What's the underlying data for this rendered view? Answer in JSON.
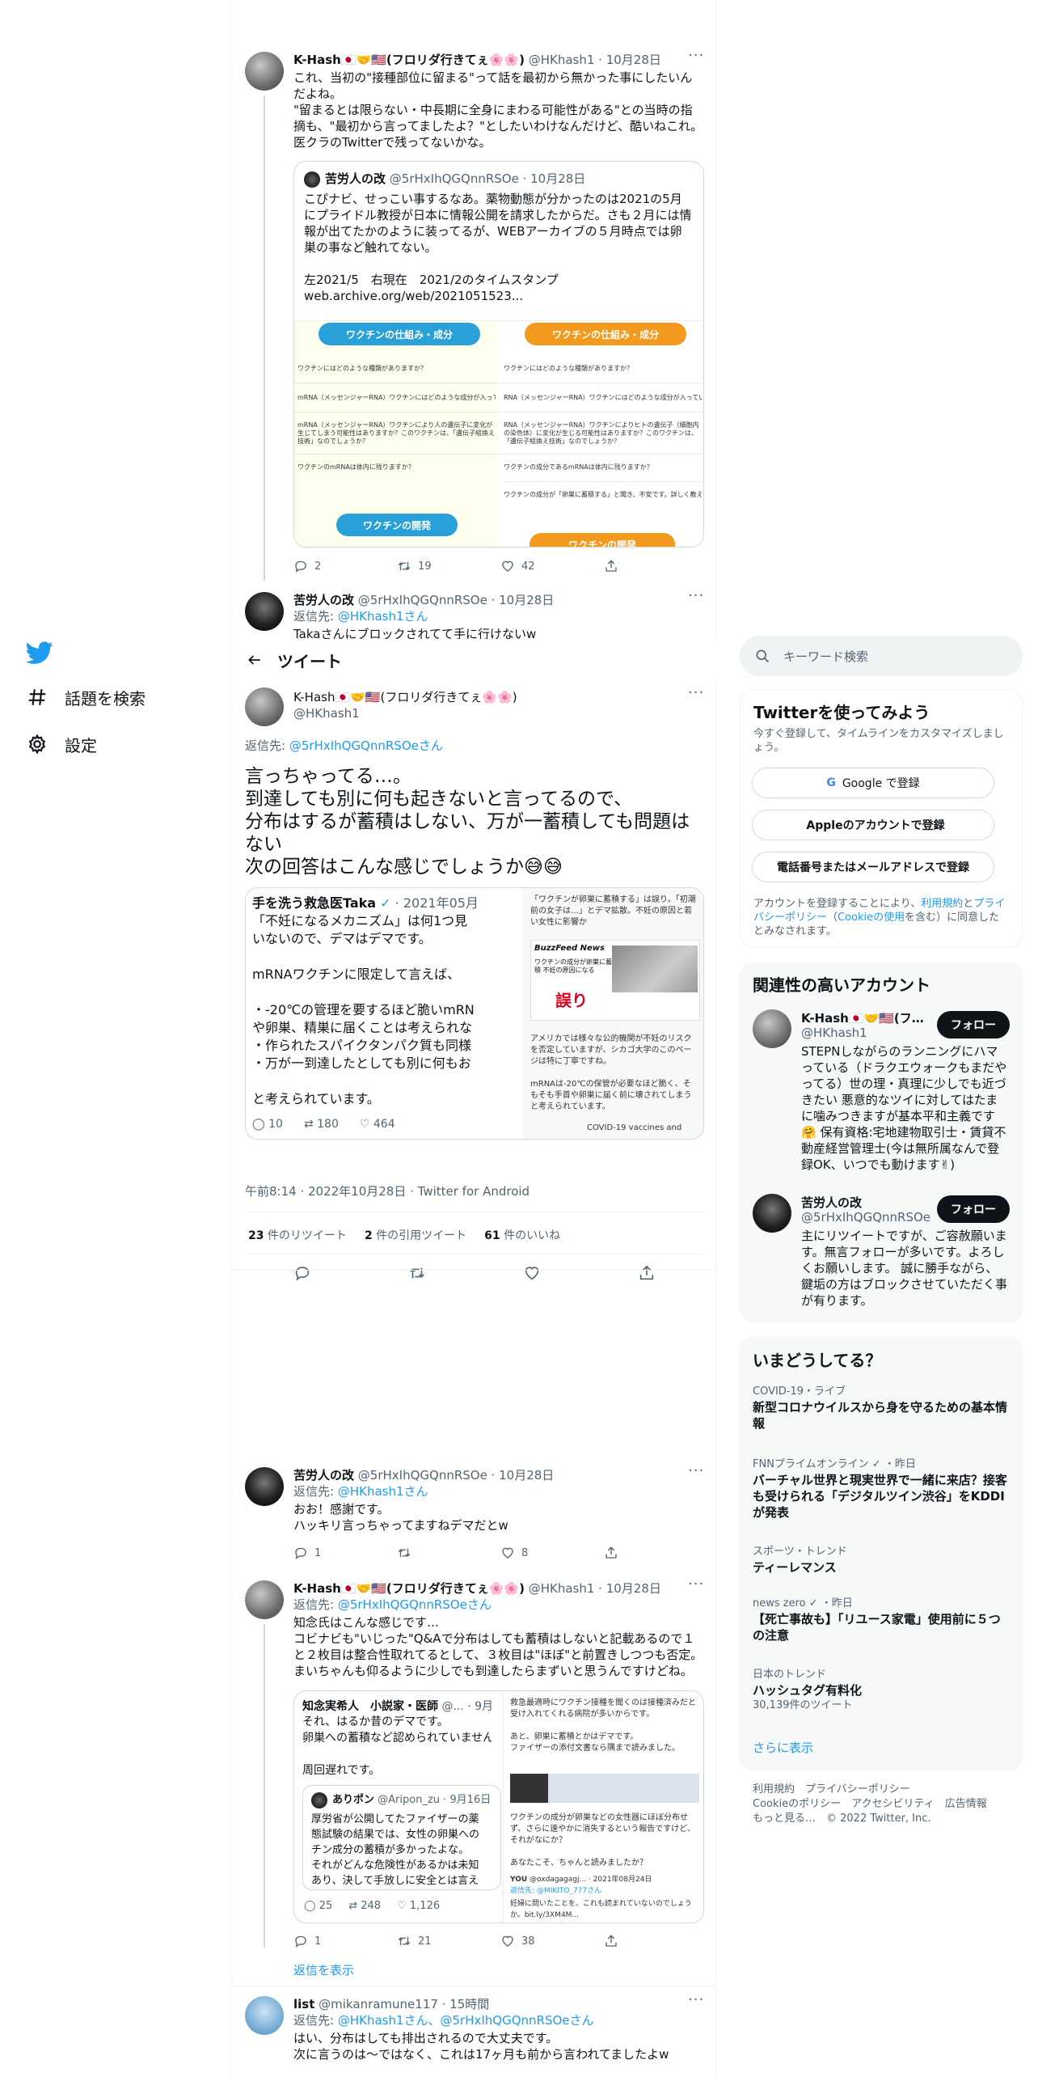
{
  "nav": {
    "explore_label": "話題を検索",
    "settings_label": "設定"
  },
  "thread_top": {
    "tweet1": {
      "name": "K-Hash🇯🇵🤝🇺🇸(フロリダ行きてぇ🌸🌸)",
      "handle": "@HKhash1 · 10月28日",
      "text": "これ、当初の\"接種部位に留まる\"って話を最初から無かった事にしたいんだよね。\n\"留まるとは限らない・中長期に全身にまわる可能性がある\"との当時の指摘も、\"最初から言ってましたよ？\"としたいわけなんだけど、酷いねこれ。\n医クラのTwitterで残ってないかな。",
      "quote": {
        "name": "苦労人の改",
        "handle": "@5rHxIhQGQnnRSOe · 10月28日",
        "text": "こぴナビ、せっこい事するなあ。薬物動態が分かったのは2021の5月にプライドル教授が日本に情報公開を請求したからだ。さも２月には情報が出てたかのように装ってるが、WEBアーカイブの５月時点では卵巣の事など触れてない。\n\n左2021/5　右現在　2021/2のタイムスタンプ",
        "link": "web.archive.org/web/2021051523...",
        "img_left_pill": "ワクチンの仕組み・成分",
        "img_left_pill2": "ワクチンの開発",
        "img_right_pill": "ワクチンの仕組み・成分",
        "img_right_pill2": "ワクチンの開発",
        "img_rows_left": [
          "ワクチンにはどのような種類がありますか？",
          "mRNA（メッセンジャーRNA）ワクチンにはどのような成分が入っていますか？",
          "mRNA（メッセンジャーRNA）ワクチンにより人の遺伝子に変化が生じてしまう可能性はありますか？このワクチンは、「遺伝子組換え技術」なのでしょうか？",
          "ワクチンのmRNAは体内に残りますか？"
        ],
        "img_rows_right": [
          "ワクチンにはどのような種類がありますか？",
          "RNA（メッセンジャーRNA）ワクチンにはどのような成分が入っていますか？",
          "RNA（メッセンジャーRNA）ワクチンによりヒトの遺伝子（細胞内の染色体）に変化が生じる可能性はありますか？このワクチンは、「遺伝子組換え技術」なのでしょうか？",
          "ワクチンの成分であるmRNAは体内に残りますか？",
          "ワクチンの成分が「卵巣に蓄積する」と聞き、不安です。詳しく教えてください。"
        ]
      },
      "stats": {
        "replies": "2",
        "retweets": "19",
        "likes": "42"
      }
    },
    "tweet2": {
      "name": "苦労人の改",
      "handle": "@5rHxIhQGQnnRSOe · 10月28日",
      "reply_prefix": "返信先: ",
      "reply_to": "@HKhash1さん",
      "text": "Takaさんにブロックされてて手に行けないw"
    }
  },
  "main": {
    "header_title": "ツイート",
    "name": "K-Hash🇯🇵🤝🇺🇸(フロリダ行きてぇ🌸🌸)",
    "handle": "@HKhash1",
    "reply_prefix": "返信先: ",
    "reply_to": "@5rHxIhQGQnnRSOeさん",
    "text": "言っちゃってる…。\n到達しても別に何も起きないと言ってるので、\n分布はするが蓄積はしない、万が一蓄積しても問題はない\n次の回答はこんな感じでしょうか😅😅",
    "quote_left": {
      "name": "手を洗う救急医Taka",
      "date": "· 2021年05月",
      "text": "「不妊になるメカニズム」は何1つ見\nいないので、デマはデマです。\n\nmRNAワクチンに限定して言えば、\n\n・-20℃の管理を要するほど脆いmRN\nや卵巣、精巣に届くことは考えられな\n・作られたスパイクタンパク質も同様\n・万が一到達したとしても別に何もお\n\nと考えられています。",
      "replies": "10",
      "retweets": "180",
      "likes": "464"
    },
    "quote_right": {
      "top": "「ワクチンが卵巣に蓄積する」は誤り。「初潮前の女子は…」とデマ拡散。不妊の原因と若い女性に影響か",
      "brand": "BuzzFeed News",
      "card": "ワクチンの成分が卵巣に蓄積 不妊の原因になる",
      "stamp": "誤り",
      "body": "アメリカでは様々な公的機関が不妊のリスクを否定していますが、シカゴ大学のこのページは特に丁寧ですね。\n\nmRNAは-20℃の保管が必要なほど脆く、そもそも手首や卵巣に届く前に壊されてしまうと考えられています。",
      "link": "COVID-19 vaccines and"
    },
    "timestamp": "午前8:14 · 2022年10月28日 · Twitter for Android",
    "retweets_num": "23",
    "retweets_label": " 件のリツイート",
    "quotes_num": "2",
    "quotes_label": " 件の引用ツイート",
    "likes_num": "61",
    "likes_label": " 件のいいね"
  },
  "replies": {
    "r1": {
      "name": "苦労人の改",
      "handle": "@5rHxIhQGQnnRSOe · 10月28日",
      "reply_prefix": "返信先: ",
      "reply_to": "@HKhash1さん",
      "text": "おお！感謝です。\nハッキリ言っちゃってますねデマだとw",
      "replies": "1",
      "retweets": "",
      "likes": "8"
    },
    "r2": {
      "name": "K-Hash🇯🇵🤝🇺🇸(フロリダ行きてぇ🌸🌸)",
      "handle": "@HKhash1 · 10月28日",
      "reply_prefix": "返信先: ",
      "reply_to": "@5rHxIhQGQnnRSOeさん",
      "text": "知念氏はこんな感じです…\nコビナビも\"いじった\"Q&Aで分布はしても蓄積はしないと記載あるので１と２枚目は整合性取れてるとして、３枚目は\"ほぼ\"と前置きしつつも否定。\nまいちゃんも仰るように少しでも到達したらまずいと思うんですけどね。",
      "quote": {
        "name": "知念実希人　小説家・医師",
        "handle": "@... · 9月",
        "text": "それ、はるか昔のデマです。\n卵巣への蓄積など認められていません\n\n周回遅れです。",
        "inner_name": "ありポン",
        "inner_handle": "@Aripon_zu · 9月16日",
        "inner_text": "厚労省が公開してたファイザーの薬\n態試験の結果では、女性の卵巣への\nチン成分の蓄積が多かったよな。\nそれがどんな危険性があるかは未知\nあり、決して手放しに安全とは言え",
        "q_replies": "25",
        "q_retweets": "248",
        "q_likes": "1,126",
        "right_text1": "救急最適時にワクチン接種を聞くのは接種済みだと受け入れてくれる病院が多いからです。\n\nあと、卵巣に蓄積とかはデマです。\nファイザーの添付文書なら隅まで読みました。",
        "right_text2": "ワクチンの成分が卵巣などの女性器にほぼ分布せず、さらに速やかに消失するという報告ですけど、それがなにか？\n\nあなたこそ、ちゃんと読みましたか？",
        "right_user": "YOU",
        "right_user_handle": "@oxdagagagj... · 2021年08月24日",
        "right_reply": "返信先: @MIKITO_777さん",
        "right_tail": "妊婦に問いたことを、これも読まれていないのでしょうか。bit.ly/3XM4M..."
      },
      "replies": "1",
      "retweets": "21",
      "likes": "38"
    },
    "show_replies": "返信を表示",
    "r3": {
      "name": "list",
      "handle": "@mikanramune117 · 15時間",
      "reply_prefix": "返信先: ",
      "reply_to": "@HKhash1さん、@5rHxIhQGQnnRSOeさん",
      "text": "はい、分布はしても排出されるので大丈夫です。\n次に言うのは～ではなく、これは17ヶ月も前から言われてましたよw"
    }
  },
  "sidebar": {
    "search_placeholder": "キーワード検索",
    "signup": {
      "title": "Twitterを使ってみよう",
      "subtitle": "今すぐ登録して、タイムラインをカスタマイズしましょう。",
      "google": "Google で登録",
      "apple": "Appleのアカウントで登録",
      "phone": "電話番号またはメールアドレスで登録",
      "terms_pre": "アカウントを登録することにより、",
      "terms_link1": "利用規約",
      "terms_mid": "と",
      "terms_link2": "プライバシーポリシー",
      "terms_mid2": "（",
      "terms_link3": "Cookieの使用",
      "terms_post": "を含む）に同意したとみなされます。"
    },
    "related": {
      "title": "関連性の高いアカウント",
      "follow": "フォロー",
      "accounts": [
        {
          "name": "K-Hash🇯🇵🤝🇺🇸(フ…",
          "handle": "@HKhash1",
          "bio": "STEPNしながらのランニングにハマっている（ドラクエウォークもまだやってる）世の理・真理に少しでも近づきたい 悪意的なツイに対してはたまに噛みつきますが基本平和主義です🤗 保有資格:宅地建物取引士・賃貸不動産経営管理士(今は無所属なんで登録OK、いつでも動けます✌)"
        },
        {
          "name": "苦労人の改",
          "handle": "@5rHxIhQGQnnRSOe",
          "bio": "主にリツイートですが、ご容赦願います。無言フォローが多いです。よろしくお願いします。 誠に勝手ながら、鍵垢の方はブロックさせていただく事が有ります。"
        }
      ]
    },
    "trends": {
      "title": "いまどうしてる？",
      "items": [
        {
          "cat": "COVID-19・ライブ",
          "title": "新型コロナウイルスから身を守るための基本情報",
          "count": ""
        },
        {
          "cat": "FNNプライムオンライン ✓ ・昨日",
          "title": "バーチャル世界と現実世界で一緒に来店？接客も受けられる「デジタルツイン渋谷」をKDDIが発表",
          "count": ""
        },
        {
          "cat": "スポーツ・トレンド",
          "title": "ティーレマンス",
          "count": ""
        },
        {
          "cat": "news zero ✓ ・昨日",
          "title": "【死亡事故も】「リユース家電」使用前に５つの注意",
          "count": ""
        },
        {
          "cat": "日本のトレンド",
          "title": "ハッシュタグ有料化",
          "count": "30,139件のツイート"
        }
      ],
      "more": "さらに表示"
    },
    "footer": "利用規約　プライバシーポリシー\nCookieのポリシー　アクセシビリティ　広告情報\nもっと見る…　© 2022 Twitter, Inc."
  },
  "colors": {
    "accent": "#1d9bf0",
    "text": "#0f1419",
    "muted": "#536471",
    "border": "#cfd9de"
  }
}
